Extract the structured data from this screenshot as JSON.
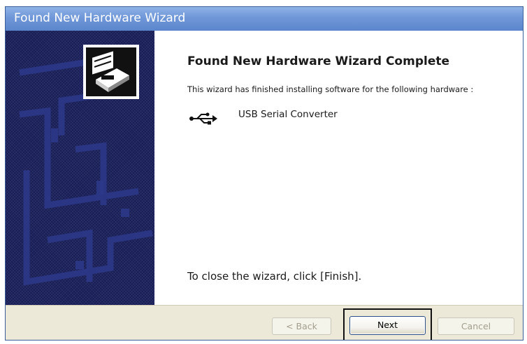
{
  "window": {
    "title": "Found New Hardware Wizard"
  },
  "content": {
    "heading": "Found New Hardware Wizard Complete",
    "description": "This wizard has finished installing software for the following hardware :",
    "device": {
      "icon": "usb-icon",
      "name": "USB Serial Converter"
    },
    "close_instruction": "To close the wizard, click [Finish]."
  },
  "buttons": {
    "back_label": "< Back",
    "next_label": "Next",
    "cancel_label": "Cancel"
  },
  "colors": {
    "title_bar": "#6f97d8",
    "side_panel": "#171d56",
    "button_bar": "#ece9d8"
  }
}
